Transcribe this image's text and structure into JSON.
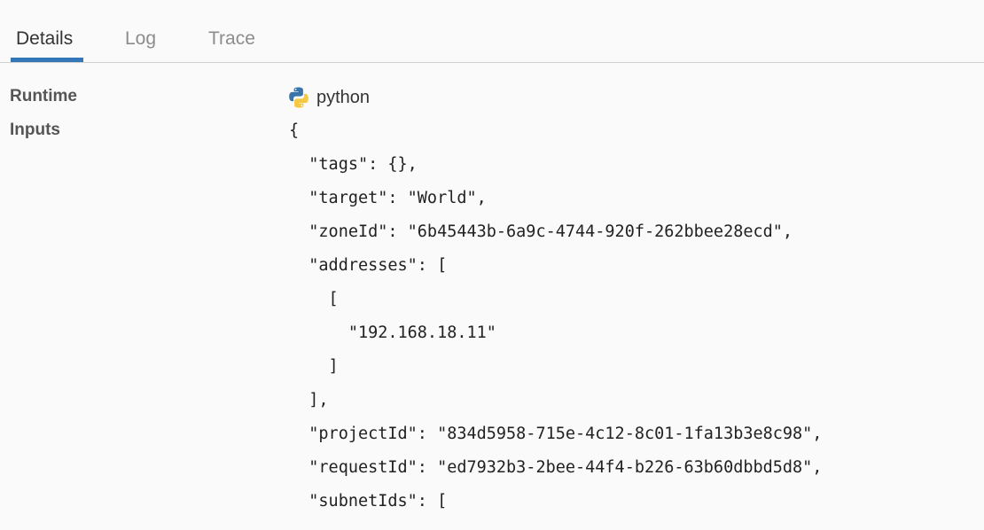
{
  "tabs": [
    {
      "label": "Details",
      "active": true
    },
    {
      "label": "Log",
      "active": false
    },
    {
      "label": "Trace",
      "active": false
    }
  ],
  "accent_color": "#3276b7",
  "fields": {
    "runtime_label": "Runtime",
    "runtime_value": "python",
    "runtime_icon": "python-logo-icon",
    "inputs_label": "Inputs"
  },
  "inputs_lines": [
    "{",
    "  \"tags\": {},",
    "  \"target\": \"World\",",
    "  \"zoneId\": \"6b45443b-6a9c-4744-920f-262bbee28ecd\",",
    "  \"addresses\": [",
    "    [",
    "      \"192.168.18.11\"",
    "    ]",
    "  ],",
    "  \"projectId\": \"834d5958-715e-4c12-8c01-1fa13b3e8c98\",",
    "  \"requestId\": \"ed7932b3-2bee-44f4-b226-63b60dbbd5d8\",",
    "  \"subnetIds\": ["
  ]
}
